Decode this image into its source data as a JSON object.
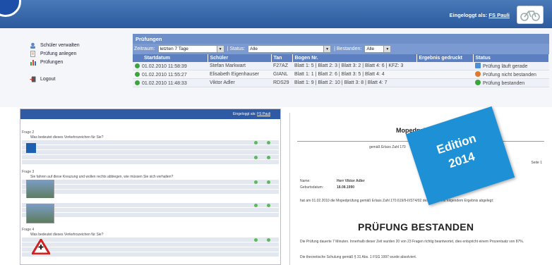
{
  "top_app": {
    "login_label": "Eingeloggt als:",
    "login_user": "FS Pauli",
    "nav": [
      {
        "label": "Schüler verwalten",
        "icon": "users-icon"
      },
      {
        "label": "Prüfung anlegen",
        "icon": "document-icon"
      },
      {
        "label": "Prüfungen",
        "icon": "bar-chart-icon"
      },
      {
        "label": "Logout",
        "icon": "logout-icon"
      }
    ],
    "panel_title": "Prüfungen",
    "filter": {
      "zeitraum_label": "Zeitraum:",
      "zeitraum_value": "letzten 7 Tage",
      "status_label": "| Status:",
      "status_value": "Alle",
      "bestanden_label": "| Bestanden:",
      "bestanden_value": "Alle"
    },
    "columns": [
      "Startdatum",
      "Schüler",
      "Tan",
      "Bogen Nr.",
      "Ergebnis gedruckt",
      "Status"
    ],
    "rows": [
      {
        "date": "01.02.2010 11:58:39",
        "student": "Stefan Markwart",
        "tan": "F27AZ",
        "bogen": "Blatt 1: 5 | Blatt 2: 3 | Blatt 3: 2 | Blatt 4: 6 | KFZ: 3",
        "printed": "",
        "status": "Prüfung läuft gerade",
        "status_color": "#4a8fd6"
      },
      {
        "date": "01.02.2010 11:55:27",
        "student": "Elisabeth Eigenhauser",
        "tan": "GIANL",
        "bogen": "Blatt 1: 1 | Blatt 2: 6 | Blatt 3: 5 | Blatt 4: 4",
        "printed": "",
        "status": "Prüfung nicht bestanden",
        "status_color": "#e07a2e"
      },
      {
        "date": "01.02.2010 11:48:33",
        "student": "Viktor Adler",
        "tan": "RDS29",
        "bogen": "Blatt 1: 9 | Blatt 2: 10 | Blatt 3: 8 | Blatt 4: 7",
        "printed": "",
        "status": "Prüfung bestanden",
        "status_color": "#3aa53a"
      }
    ]
  },
  "bottom_left": {
    "login_label": "Eingeloggt als:",
    "login_user": "FS Pauli",
    "questions": [
      {
        "label": "Frage 2",
        "title": "Was bedeutet dieses Verkehrszeichen für Sie?"
      },
      {
        "label": "Frage 3",
        "title": "Sie fahren auf diese Kreuzung und wollen rechts abbiegen, wie müssen Sie sich verhalten?"
      },
      {
        "label": "Frage 4",
        "title": "Was bedeutet dieses Verkehrszeichen für Sie?"
      }
    ]
  },
  "document": {
    "title": "Mopedprüfung",
    "subtitle": "gemäß Erlass Zahl 170",
    "page": "Seite 1",
    "name_label": "Name:",
    "name_value": "Herr Viktor Adler",
    "dob_label": "Geburtsdatum:",
    "dob_value": "18.08.1990",
    "intro": "hat am 01.02.2010 die Mopedprüfung gemäß Erlass Zahl 170.619/9-II/ST4/02 des BMVIT mit folgendem Ergebnis abgelegt:",
    "result": "PRÜFUNG BESTANDEN",
    "detail": "Die Prüfung dauerte 7 Minuten. Innerhalb dieser Zeit wurden 20 von 23 Fragen richtig beantwortet, dies entspricht einem Prozentsatz von 87%.",
    "footer": "Die theoretische Schulung gemäß § 31 Abs. 1 FSG 1997 wurde absolviert."
  },
  "badge": {
    "line1": "Edition",
    "line2": "2014",
    "color": "#1e90d6"
  }
}
